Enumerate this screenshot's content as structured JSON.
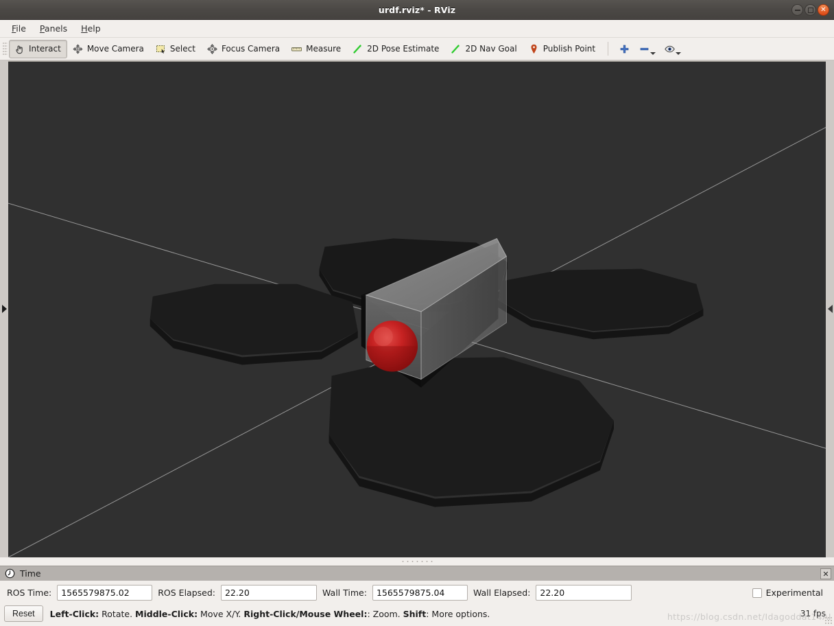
{
  "window": {
    "title": "urdf.rviz* - RViz",
    "buttons": [
      {
        "name": "minimize",
        "glyph": "–"
      },
      {
        "name": "maximize",
        "glyph": "□"
      },
      {
        "name": "close",
        "glyph": "×"
      }
    ]
  },
  "menubar": {
    "items": [
      {
        "mnemonic": "F",
        "rest": "ile",
        "name": "file"
      },
      {
        "mnemonic": "P",
        "rest": "anels",
        "name": "panels"
      },
      {
        "mnemonic": "H",
        "rest": "elp",
        "name": "help"
      }
    ]
  },
  "toolbar": {
    "tools": [
      {
        "label": "Interact",
        "icon": "hand-cursor-icon",
        "active": true
      },
      {
        "label": "Move Camera",
        "icon": "move-camera-icon",
        "active": false
      },
      {
        "label": "Select",
        "icon": "select-rectangle-icon",
        "active": false
      },
      {
        "label": "Focus Camera",
        "icon": "focus-camera-icon",
        "active": false
      },
      {
        "label": "Measure",
        "icon": "ruler-icon",
        "active": false
      },
      {
        "label": "2D Pose Estimate",
        "icon": "pose-arrow-icon",
        "active": false
      },
      {
        "label": "2D Nav Goal",
        "icon": "nav-goal-arrow-icon",
        "active": false
      },
      {
        "label": "Publish Point",
        "icon": "map-pin-icon",
        "active": false
      }
    ],
    "extras": [
      {
        "name": "add-tool-button",
        "icon": "plus-icon",
        "has_dropdown": false
      },
      {
        "name": "remove-tool-button",
        "icon": "minus-icon",
        "has_dropdown": true
      },
      {
        "name": "visibility-button",
        "icon": "eye-icon",
        "has_dropdown": true
      }
    ]
  },
  "viewport": {
    "background_color": "#303030",
    "grid_line_color": "#b9b9b9",
    "box_color": "#c8c8c8",
    "sphere_color": "#b81414",
    "wheel_color": "#1b1b1b",
    "left_handle_icon": "expand-left-panel-arrow",
    "right_handle_icon": "expand-right-panel-arrow"
  },
  "time_panel": {
    "title": "Time",
    "icon": "clock-icon",
    "close_icon": "close-icon",
    "fields": [
      {
        "label": "ROS Time:",
        "value": "1565579875.02",
        "name": "ros-time"
      },
      {
        "label": "ROS Elapsed:",
        "value": "22.20",
        "name": "ros-elapsed"
      },
      {
        "label": "Wall Time:",
        "value": "1565579875.04",
        "name": "wall-time"
      },
      {
        "label": "Wall Elapsed:",
        "value": "22.20",
        "name": "wall-elapsed"
      }
    ],
    "experimental_label": "Experimental",
    "experimental_checked": false
  },
  "status_bar": {
    "reset_label": "Reset",
    "hint_segments": [
      {
        "text": "Left-Click:",
        "bold": true
      },
      {
        "text": " Rotate. ",
        "bold": false
      },
      {
        "text": "Middle-Click:",
        "bold": true
      },
      {
        "text": " Move X/Y. ",
        "bold": false
      },
      {
        "text": "Right-Click/Mouse Wheel:",
        "bold": true
      },
      {
        "text": ": Zoom. ",
        "bold": false
      },
      {
        "text": "Shift",
        "bold": true
      },
      {
        "text": ": More options.",
        "bold": false
      }
    ],
    "fps": "31 fps",
    "watermark": "https://blog.csdn.net/Idagoddat14AI"
  }
}
